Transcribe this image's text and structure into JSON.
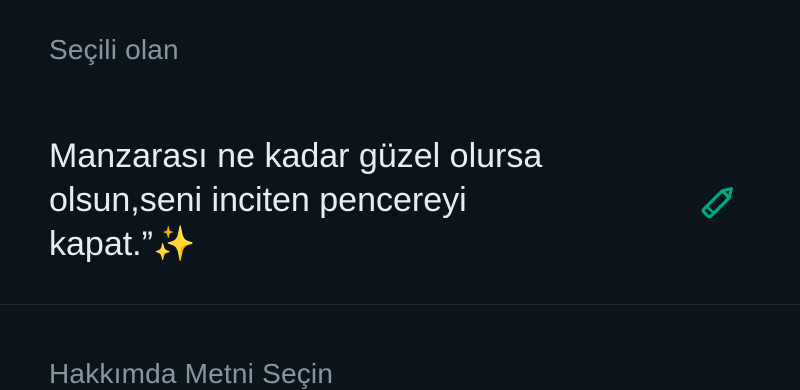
{
  "selected_section": {
    "header": "Seçili olan",
    "about_text": "Manzarası ne kadar güzel olursa\nolsun,seni inciten pencereyi\nkapat.”✨",
    "edit_icon": "pencil-icon"
  },
  "choose_section": {
    "header": "Hakkımda Metni Seçin"
  },
  "colors": {
    "background": "#0b141a",
    "accent": "#00a884",
    "header_text": "#8696a0",
    "primary_text": "#e9edef"
  }
}
